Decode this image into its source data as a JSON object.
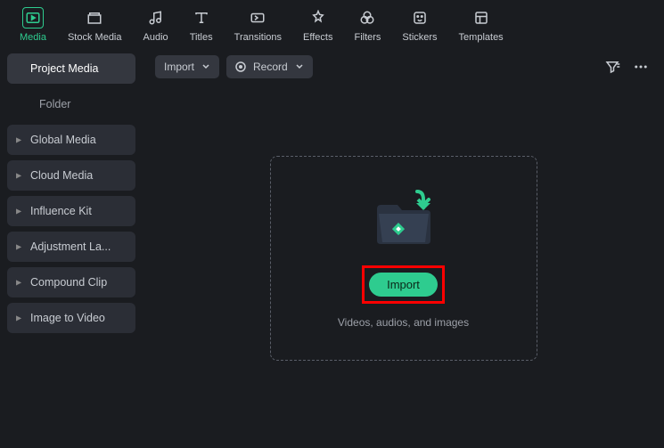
{
  "toolbar": {
    "items": [
      {
        "label": "Media",
        "icon": "media",
        "active": true
      },
      {
        "label": "Stock Media",
        "icon": "stock"
      },
      {
        "label": "Audio",
        "icon": "audio"
      },
      {
        "label": "Titles",
        "icon": "titles"
      },
      {
        "label": "Transitions",
        "icon": "transitions"
      },
      {
        "label": "Effects",
        "icon": "effects"
      },
      {
        "label": "Filters",
        "icon": "filters"
      },
      {
        "label": "Stickers",
        "icon": "stickers"
      },
      {
        "label": "Templates",
        "icon": "templates"
      }
    ]
  },
  "sidebar": {
    "items": [
      {
        "label": "Project Media",
        "active": true,
        "hasChevron": false
      },
      {
        "label": "Folder",
        "type": "folder"
      },
      {
        "label": "Global Media",
        "hasChevron": true
      },
      {
        "label": "Cloud Media",
        "hasChevron": true
      },
      {
        "label": "Influence Kit",
        "hasChevron": true
      },
      {
        "label": "Adjustment La...",
        "hasChevron": true
      },
      {
        "label": "Compound Clip",
        "hasChevron": true
      },
      {
        "label": "Image to Video",
        "hasChevron": true
      }
    ]
  },
  "contentToolbar": {
    "import_label": "Import",
    "record_label": "Record"
  },
  "dropzone": {
    "import_button_label": "Import",
    "hint_text": "Videos, audios, and images"
  },
  "colors": {
    "accent": "#2ecc8f",
    "highlight": "#ff0000"
  }
}
